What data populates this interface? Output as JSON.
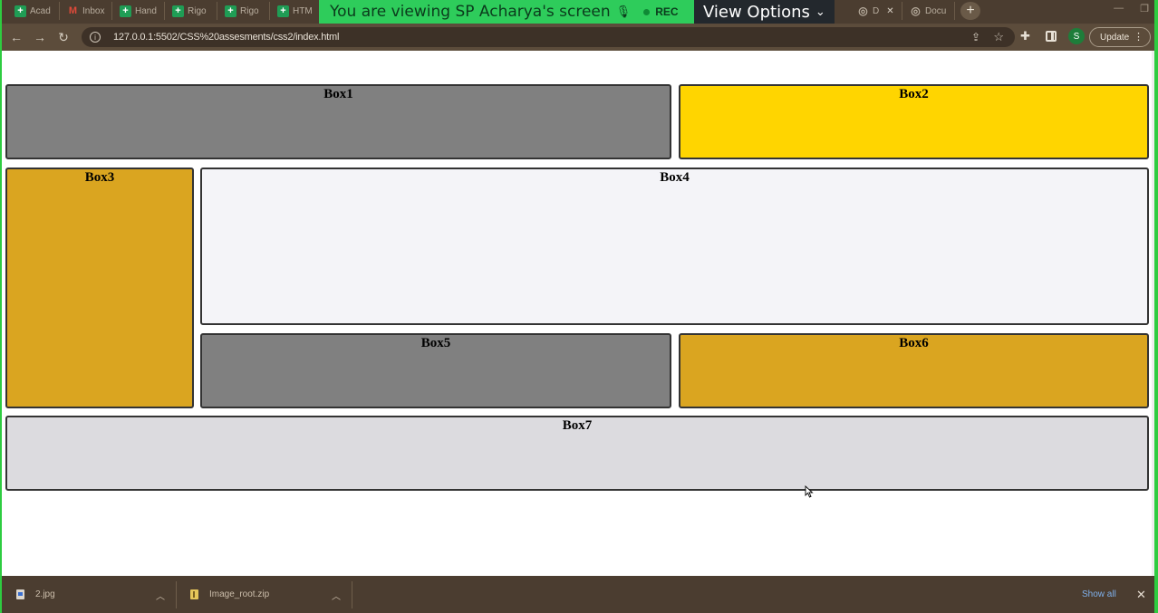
{
  "browser": {
    "tabs": [
      {
        "label": "Acad",
        "icon": "sheets-icon"
      },
      {
        "label": "Inbox",
        "icon": "gmail-icon"
      },
      {
        "label": "Hand",
        "icon": "sheets-icon"
      },
      {
        "label": "Rigo",
        "icon": "sheets-icon"
      },
      {
        "label": "Rigo",
        "icon": "sheets-icon"
      },
      {
        "label": "HTM",
        "icon": "sheets-icon"
      },
      {
        "label": "D",
        "icon": "globe-icon",
        "close": "✕"
      },
      {
        "label": "Docu",
        "icon": "globe-icon"
      }
    ],
    "share_banner": {
      "text": "You are viewing SP Acharya's screen",
      "rec_label": "REC",
      "view_options_label": "View Options"
    },
    "url": "127.0.0.1:5502/CSS%20assesments/css2/index.html",
    "profile_initial": "S",
    "update_label": "Update"
  },
  "page": {
    "boxes": [
      {
        "label": "Box1",
        "color": "#808080"
      },
      {
        "label": "Box2",
        "color": "#ffd500"
      },
      {
        "label": "Box3",
        "color": "#daa520"
      },
      {
        "label": "Box4",
        "color": "#f4f4f8"
      },
      {
        "label": "Box5",
        "color": "#808080"
      },
      {
        "label": "Box6",
        "color": "#daa520"
      },
      {
        "label": "Box7",
        "color": "#dcdbdf"
      }
    ]
  },
  "downloads": {
    "items": [
      {
        "name": "2.jpg"
      },
      {
        "name": "Image_root.zip"
      }
    ],
    "show_all_label": "Show all"
  }
}
